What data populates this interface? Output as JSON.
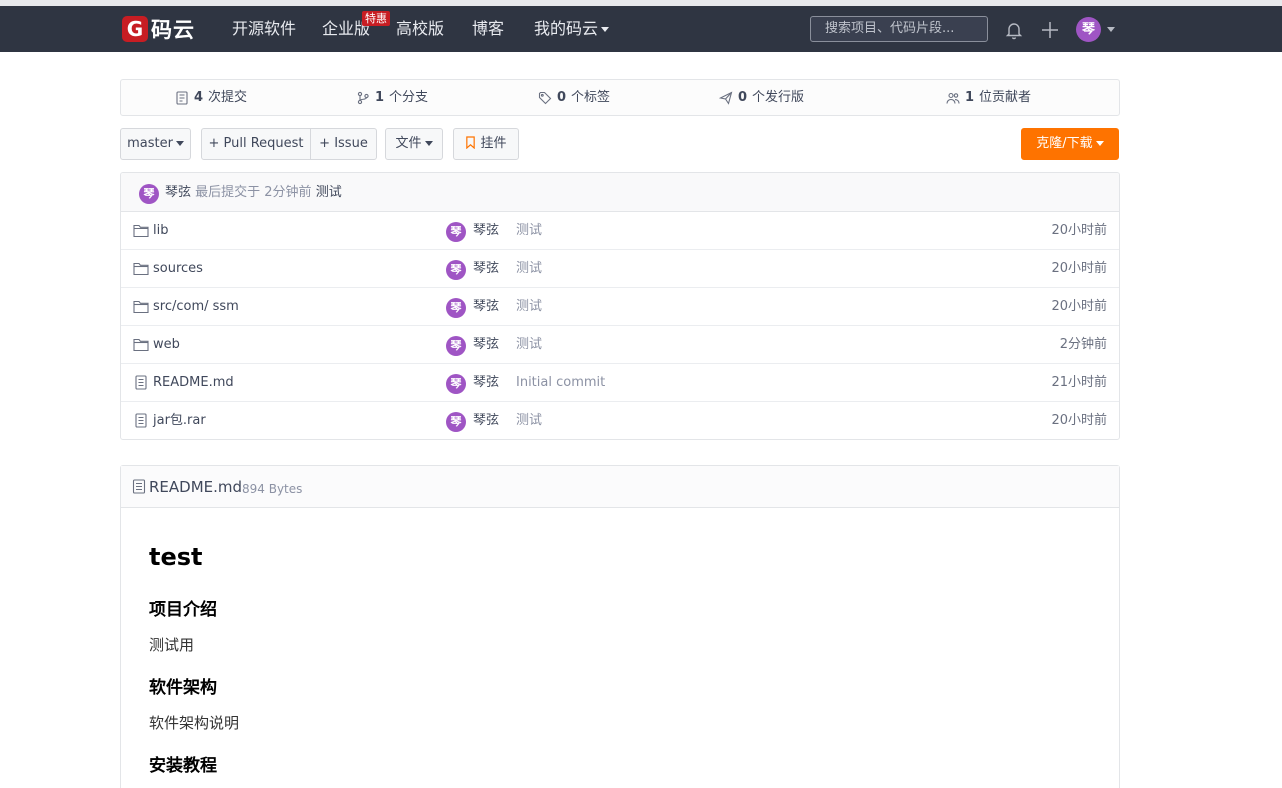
{
  "nav": {
    "logo_mark": "G",
    "logo_text": "码云",
    "items": [
      "开源软件",
      "企业版",
      "高校版",
      "博客",
      "我的码云"
    ],
    "badge": "特惠",
    "search_placeholder": "搜索项目、代码片段...",
    "avatar": "琴"
  },
  "stats": [
    {
      "count": "4",
      "label": "次提交",
      "icon": "commits-icon"
    },
    {
      "count": "1",
      "label": "个分支",
      "icon": "branch-icon"
    },
    {
      "count": "0",
      "label": "个标签",
      "icon": "tag-icon"
    },
    {
      "count": "0",
      "label": "个发行版",
      "icon": "release-icon"
    },
    {
      "count": "1",
      "label": "位贡献者",
      "icon": "contributors-icon"
    }
  ],
  "toolbar": {
    "branch": "master",
    "pull_request": "+ Pull Request",
    "issue": "+ Issue",
    "files": "文件",
    "widget": "挂件",
    "clone": "克隆/下载"
  },
  "latest_commit": {
    "avatar": "琴",
    "author": "琴弦",
    "text": "最后提交于 2分钟前",
    "message": "测试"
  },
  "files": [
    {
      "name": "lib",
      "type": "folder",
      "avatar": "琴",
      "author": "琴弦",
      "message": "测试",
      "time": "20小时前"
    },
    {
      "name": "sources",
      "type": "folder",
      "avatar": "琴",
      "author": "琴弦",
      "message": "测试",
      "time": "20小时前"
    },
    {
      "name": "src/com/ ssm",
      "type": "folder",
      "avatar": "琴",
      "author": "琴弦",
      "message": "测试",
      "time": "20小时前"
    },
    {
      "name": "web",
      "type": "folder",
      "avatar": "琴",
      "author": "琴弦",
      "message": "测试",
      "time": "2分钟前"
    },
    {
      "name": "README.md",
      "type": "file",
      "avatar": "琴",
      "author": "琴弦",
      "message": "Initial commit",
      "time": "21小时前"
    },
    {
      "name": "jar包.rar",
      "type": "file",
      "avatar": "琴",
      "author": "琴弦",
      "message": "测试",
      "time": "20小时前"
    }
  ],
  "readme": {
    "filename": "README.md",
    "size": "894 Bytes",
    "h1": "test",
    "sections": [
      {
        "heading": "项目介绍",
        "body": "测试用"
      },
      {
        "heading": "软件架构",
        "body": "软件架构说明"
      },
      {
        "heading": "安装教程",
        "body": ""
      }
    ]
  },
  "colors": {
    "navbar": "#2f3542",
    "brand_red": "#c71d23",
    "clone_orange": "#fe7300",
    "avatar_purple": "#9f55c4"
  }
}
